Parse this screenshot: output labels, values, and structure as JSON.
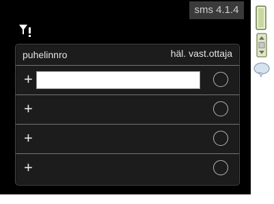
{
  "header": {
    "menu_code": "sms 4.1.4",
    "menu_icon": "filter-alert-icon"
  },
  "table": {
    "col_number": "puhelinnro",
    "col_alarm": "häl. vast.ottaja",
    "rows": [
      {
        "add_icon": "+",
        "value": "",
        "selected": false
      },
      {
        "add_icon": "+",
        "value": "",
        "selected": false
      },
      {
        "add_icon": "+",
        "value": "",
        "selected": false
      },
      {
        "add_icon": "+",
        "value": "",
        "selected": false
      }
    ]
  },
  "side": {
    "icons": [
      "green-bar-icon",
      "scroll-slider-icon",
      "help-bubble-icon"
    ]
  }
}
